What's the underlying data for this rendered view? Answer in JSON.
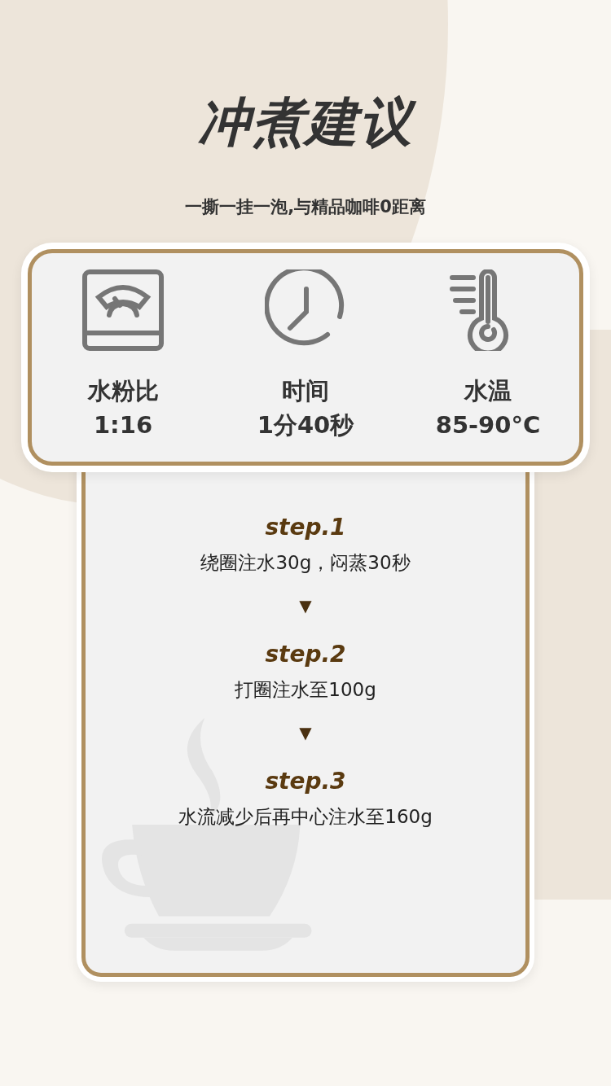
{
  "title": "冲煮建议",
  "subtitle": "一撕一挂一泡,与精品咖啡0距离",
  "params": [
    {
      "kind": "scale",
      "label": "水粉比",
      "value": "1:16"
    },
    {
      "kind": "clock",
      "label": "时间",
      "value": "1分40秒"
    },
    {
      "kind": "thermometer",
      "label": "水温",
      "value": "85-90°C"
    }
  ],
  "steps": [
    {
      "label": "step.1",
      "text": "绕圈注水30g，闷蒸30秒",
      "arrow": "▼"
    },
    {
      "label": "step.2",
      "text": "打圈注水至100g",
      "arrow": "▼"
    },
    {
      "label": "step.3",
      "text": "水流减少后再中心注水至160g"
    }
  ]
}
